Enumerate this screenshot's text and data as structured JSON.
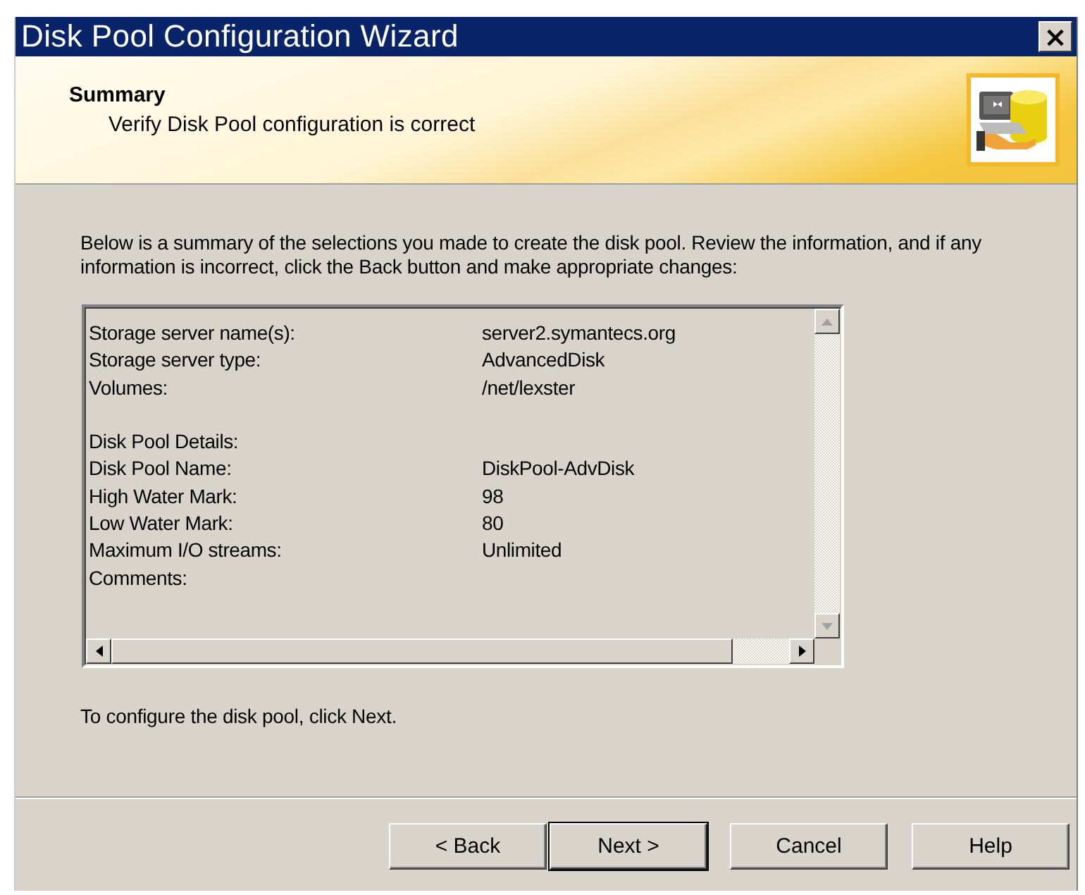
{
  "window": {
    "title": "Disk Pool Configuration Wizard",
    "close": "×"
  },
  "header": {
    "title": "Summary",
    "subtitle": "Verify Disk Pool configuration is correct"
  },
  "intro": "Below is a summary of the selections you made to create the disk pool. Review the information, and if any information is incorrect, click the Back button and make appropriate changes:",
  "summary": [
    {
      "kind": "field",
      "label": "Storage server name(s):",
      "value": "server2.symantecs.org"
    },
    {
      "kind": "field",
      "label": "Storage server type:",
      "value": "AdvancedDisk"
    },
    {
      "kind": "field",
      "label": "Volumes:",
      "value": "/net/lexster"
    },
    {
      "kind": "heading",
      "label": "Disk Pool Details:"
    },
    {
      "kind": "field",
      "label": "Disk Pool Name:",
      "value": "DiskPool-AdvDisk"
    },
    {
      "kind": "field",
      "label": "High Water Mark:",
      "value": "98"
    },
    {
      "kind": "field",
      "label": "Low Water Mark:",
      "value": "80"
    },
    {
      "kind": "field",
      "label": "Maximum I/O streams:",
      "value": "Unlimited"
    },
    {
      "kind": "field",
      "label": "Comments:"
    }
  ],
  "footer_note": "To configure the disk pool, click Next.",
  "buttons": [
    {
      "label": "< Back",
      "default": false
    },
    {
      "label": "Next >",
      "default": true
    },
    {
      "label": "Cancel",
      "default": false
    },
    {
      "label": "Help",
      "default": false
    }
  ]
}
